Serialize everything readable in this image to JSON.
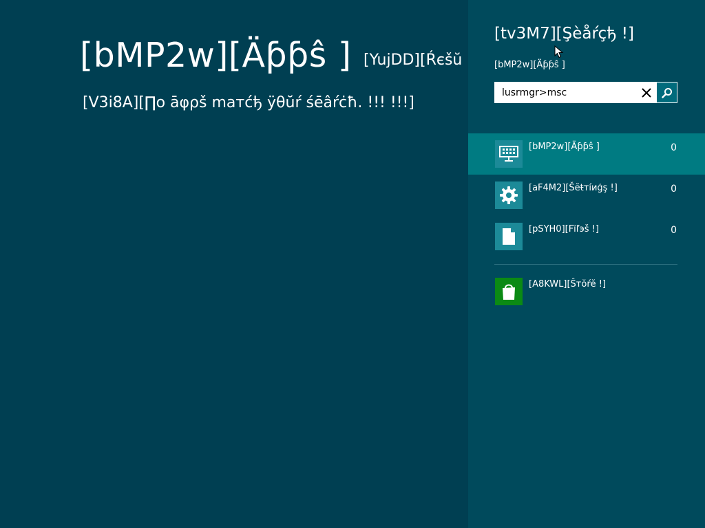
{
  "main": {
    "title": "[bMP2w][Äƥƥŝ ]",
    "subtitle": "[YujDD][Ŕєšŭ",
    "no_results": "[V3i8A][∏o āφρš maтćђ ÿθŭŕ śēâŕċħ. !!! !!!]"
  },
  "search_pane": {
    "title": "[tv3M7][Şèåŕçђ !]",
    "scope_label": "[bMP2w][Äƥƥŝ ]",
    "query": "lusrmgr>msc",
    "clear_icon": "close-icon",
    "search_icon": "magnifier-icon",
    "items": [
      {
        "label": "[bMP2w][Äƥƥŝ ]",
        "count": "0",
        "icon": "apps-icon",
        "selected": true
      },
      {
        "label": "[aF4M2][Šĕŧтíиģş !]",
        "count": "0",
        "icon": "gear-icon",
        "selected": false
      },
      {
        "label": "[pSYH0][Fïľэš !]",
        "count": "0",
        "icon": "file-icon",
        "selected": false
      }
    ],
    "store": {
      "label": "[A8KWL][Ŝтŏŕĕ !]",
      "icon": "store-bag-icon"
    }
  },
  "colors": {
    "background": "#003f52",
    "pane_background": "#004a5c",
    "selected_item": "#007b82",
    "icon_tile": "#1c8a98",
    "store_tile": "#0b8a14"
  }
}
